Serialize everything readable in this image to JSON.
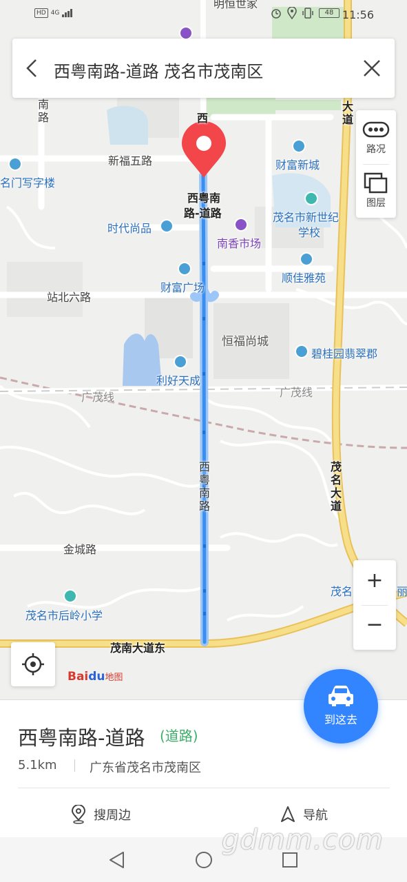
{
  "status_bar": {
    "network_left": "HD",
    "network_type": "4G",
    "battery": "48",
    "time": "11:56"
  },
  "search": {
    "title": "西粤南路-道路 茂名市茂南区"
  },
  "map": {
    "labels": {
      "mingdu": "明恒世家",
      "nan": "南",
      "lu": "路",
      "xi_top": "西",
      "xinfu5": "新福五路",
      "mingmen": "名门写字楼",
      "caifu_xincheng": "财富新城",
      "road_name_1": "西粤南",
      "road_name_2": "路-道路",
      "maoming_xinshiji_1": "茂名市新世纪",
      "maoming_xinshiji_2": "学校",
      "shidai": "时代尚品",
      "nanxiang": "南香市场",
      "shunjia": "顺佳雅苑",
      "caifu_guangchang": "财富广场",
      "zhanbei6": "站北六路",
      "hengfu": "恒福尚城",
      "bigui": "碧桂园翡翠郡",
      "lihao": "利好天成",
      "guangmao_left": "广茂线",
      "guangmao_right": "广茂线",
      "xiyue_vertical": [
        "西",
        "粤",
        "南",
        "路"
      ],
      "maoming_dadao_top": [
        "大",
        "道"
      ],
      "maoming_dadao": [
        "茂",
        "名",
        "大",
        "道"
      ],
      "jincheng": "金城路",
      "houling": "茂名市后岭小学",
      "maonan_dadao": "茂南大道东",
      "mao_right": "茂名",
      "li_right": "丽"
    },
    "colors": {
      "route": "#3a8ef0",
      "highway": "#f5d76e",
      "pin": "#f2464a",
      "water": "#a8c8f0",
      "green": "#cfe8c8"
    }
  },
  "controls": {
    "traffic_label": "路况",
    "layers_label": "图层",
    "zoom_in": "+",
    "zoom_out": "−"
  },
  "logo": {
    "bai": "Bai",
    "du": "du",
    "map": "地图"
  },
  "go_button": {
    "label": "到这去"
  },
  "place": {
    "name": "西粤南路-道路",
    "type": "(道路)",
    "distance": "5.1km",
    "address": "广东省茂名市茂南区"
  },
  "actions": {
    "nearby": "搜周边",
    "navigate": "导航"
  },
  "watermark": "gdmm.com"
}
